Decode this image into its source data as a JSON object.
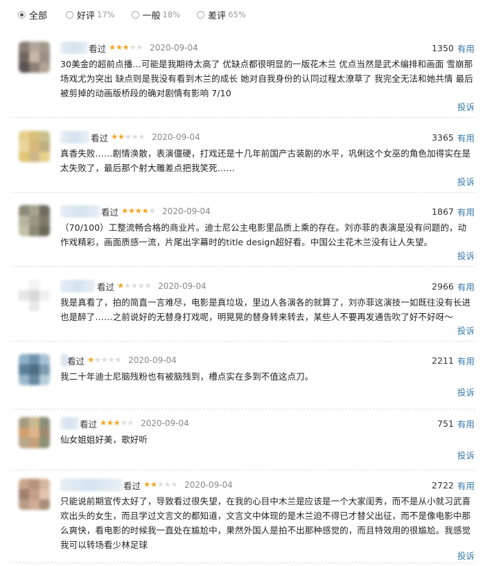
{
  "filters": [
    {
      "label": "全部",
      "pct": "",
      "checked": true
    },
    {
      "label": "好评",
      "pct": "17%",
      "checked": false
    },
    {
      "label": "一般",
      "pct": "18%",
      "checked": false
    },
    {
      "label": "差评",
      "pct": "65%",
      "checked": false
    }
  ],
  "useful_label": "有用",
  "report_label": "投诉",
  "reviews": [
    {
      "status": "看过",
      "rating": 3,
      "date": "2020-09-04",
      "votes": "1350",
      "content": "30美金的超前点播…可能是我期待太高了 优缺点都很明显的一版花木兰 优点当然是武术编排和画面 雪崩那场戏尤为突出 缺点则是我没有看到木兰的成长 她对自我身份的认同过程太潦草了 我完全无法和她共情 最后被剪掉的动画版桥段的确对剧情有影响 7/10",
      "colors": [
        "#8a7d76",
        "#b3a59c",
        "#a39a8c",
        "#6f6560",
        "#c8b7a8",
        "#9b8f85",
        "#5a5454",
        "#8d7f78",
        "#b0a294"
      ]
    },
    {
      "status": "看过",
      "rating": 2,
      "date": "2020-09-04",
      "votes": "3365",
      "content": "真香失败……剧情涣散，表演僵硬，打戏还是十几年前国产古装剧的水平，巩俐这个女巫的角色加得实在是太失败了，最后那个射大雕差点把我笑死……",
      "colors": [
        "#e6cf8a",
        "#d8bf7a",
        "#c9c08c",
        "#ead7a0",
        "#d6b97a",
        "#bfae80",
        "#e2c575",
        "#cdb78a",
        "#e8d08c"
      ]
    },
    {
      "status": "看过",
      "rating": 4,
      "date": "2020-09-04",
      "votes": "1867",
      "content": "（70/100）工整流畅合格的商业片。迪士尼公主电影里品质上乘的存在。刘亦菲的表演是没有问题的，动作戏精彩，画面质感一流，片尾出字幕时的title design超好看。中国公主花木兰没有让人失望。",
      "colors": [
        "#8a8878",
        "#a5a28e",
        "#6f6b5e",
        "#b8b49e",
        "#9a9684",
        "#7d7a6a",
        "#c4c0a8",
        "#8e8a76",
        "#6a6858"
      ]
    },
    {
      "status": "看过",
      "rating": 1,
      "date": "2020-09-04",
      "votes": "2966",
      "content": "我是真看了，拍的简直一言难尽，电影是真垃圾，里边人各演各的就算了，刘亦菲这演技一如既往没有长进也是醉了……之前说好的无替身打戏呢，明晃晃的替身转来转去，某些人不要再发通告吹了好不好呀～",
      "colors": [
        "#ffffff",
        "#f2f2f2",
        "#ffffff",
        "#e6e6e6",
        "#d9d9d9",
        "#f0f0f0",
        "#ffffff",
        "#eaeaea",
        "#ffffff"
      ]
    },
    {
      "status": "看过",
      "rating": 1,
      "date": "2020-09-04",
      "votes": "2211",
      "content": "我二十年迪士尼脑残粉也有被脑残到，槽点实在多到不值这点刀。",
      "colors": [
        "#8fb0c6",
        "#6e93ad",
        "#a9c3d4",
        "#5a7f99",
        "#4f6f86",
        "#7c9bb0",
        "#9ab7c9",
        "#6a8aa0",
        "#b5ccd9"
      ]
    },
    {
      "status": "看过",
      "rating": 3,
      "date": "2020-09-04",
      "votes": "751",
      "content": "仙女姐姐好美，歌好听",
      "colors": [
        "#a49a80",
        "#c9b88e",
        "#8a8f78",
        "#d0a070",
        "#e0b48c",
        "#9c8a6e",
        "#b8a888",
        "#c4a07a",
        "#8e9078"
      ]
    },
    {
      "status": "看过",
      "rating": 2,
      "date": "2020-09-04",
      "votes": "2722",
      "content": "只能说前期宣传太好了，导致看过很失望，在我的心目中木兰是应该是一个大家闺秀，而不是从小就习武喜欢出头的女生，而且学过文言文的都知道，文言文中体现的是木兰迫不得已才替父出征，而不是像电影中那么爽快，看电影的时候我一直处在尴尬中，果然外国人是拍不出那种感觉的，而且特效用的很尴尬。我感觉我可以转场看少林足球",
      "colors": [
        "#c9a48c",
        "#b8927a",
        "#d6b8a0",
        "#a08070",
        "#c4a08a",
        "#e0c4b0",
        "#b89c88",
        "#d0ac94",
        "#a88c7c"
      ]
    }
  ]
}
